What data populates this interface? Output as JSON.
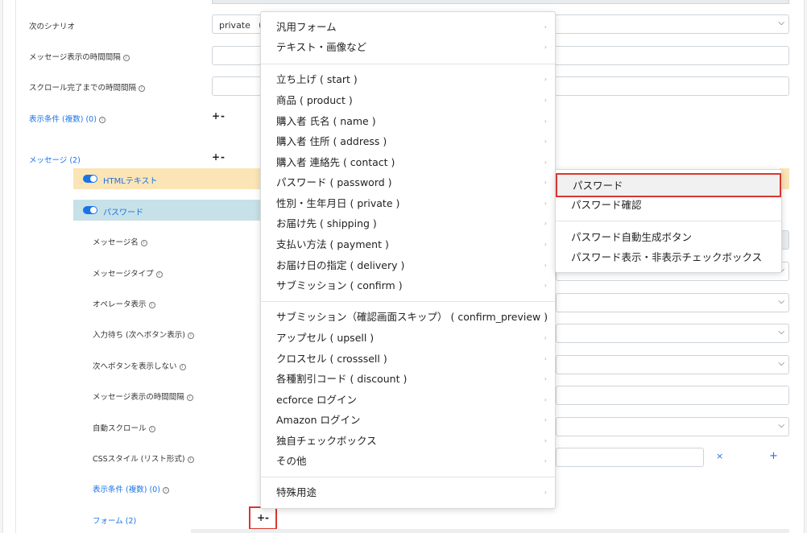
{
  "form": {
    "next_scenario_label": "次のシナリオ",
    "next_scenario_value": "private （f",
    "message_interval_label": "メッセージ表示の時間間隔",
    "scroll_interval_label": "スクロール完了までの時間間隔",
    "display_conditions_label": "表示条件 (複数) (0)",
    "messages_label": "メッセージ (2)",
    "plus_minus": "+-",
    "html_text_bar": "HTMLテキスト",
    "password_bar": "パスワード",
    "message_name_label": "メッセージ名",
    "message_type_label": "メッセージタイプ",
    "operator_display_label": "オペレータ表示",
    "input_wait_label": "入力待ち (次へボタン表示)",
    "hide_next_label": "次へボタンを表示しない",
    "message_interval2_label": "メッセージ表示の時間間隔",
    "auto_scroll_label": "自動スクロール",
    "css_style_label": "CSSスタイル (リスト形式)",
    "display_conditions2_label": "表示条件 (複数) (0)",
    "forms_label": "フォーム (2)",
    "remove_symbol": "×",
    "add_symbol": "+"
  },
  "menu": {
    "groups": [
      [
        "汎用フォーム",
        "テキスト・画像など"
      ],
      [
        "立ち上げ ( start )",
        "商品 ( product )",
        "購入者 氏名 ( name )",
        "購入者 住所 ( address )",
        "購入者 連絡先 ( contact )",
        "パスワード ( password )",
        "性別・生年月日 ( private )",
        "お届け先 ( shipping )",
        "支払い方法 ( payment )",
        "お届け日の指定 ( delivery )",
        "サブミッション ( confirm )"
      ],
      [
        "サブミッション（確認画面スキップ） ( confirm_preview )",
        "アップセル ( upsell )",
        "クロスセル ( crosssell )",
        "各種割引コード ( discount )",
        "ecforce ログイン",
        "Amazon ログイン",
        "独自チェックボックス",
        "その他"
      ],
      [
        "特殊用途"
      ]
    ],
    "arrow": "›"
  },
  "submenu": {
    "items": [
      "パスワード",
      "パスワード確認",
      "パスワード自動生成ボタン",
      "パスワード表示・非表示チェックボックス"
    ]
  },
  "colors": {
    "accent": "#1a73e8",
    "highlight_border": "#d9372f",
    "orange_bar": "#fbe5b6",
    "blue_bar": "#c6e1e8"
  }
}
